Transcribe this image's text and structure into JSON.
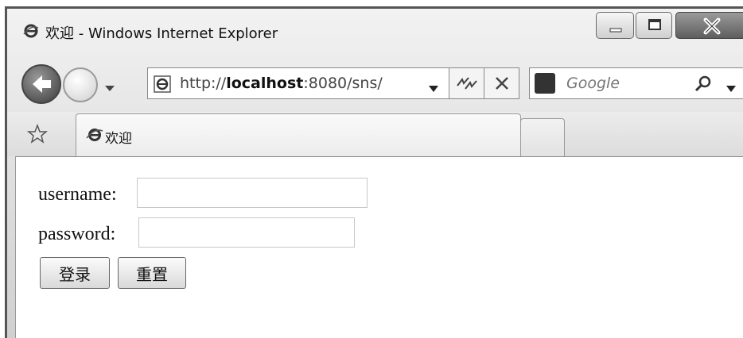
{
  "window": {
    "title": "欢迎 - Windows Internet Explorer"
  },
  "nav": {
    "address_prefix": "http://",
    "address_host": "localhost",
    "address_suffix": ":8080/sns/",
    "search_placeholder": "Google"
  },
  "tabs": [
    {
      "label": "欢迎"
    }
  ],
  "form": {
    "username_label": "username:",
    "password_label": "password:",
    "username_value": "",
    "password_value": "",
    "login_button": "登录",
    "reset_button": "重置"
  }
}
